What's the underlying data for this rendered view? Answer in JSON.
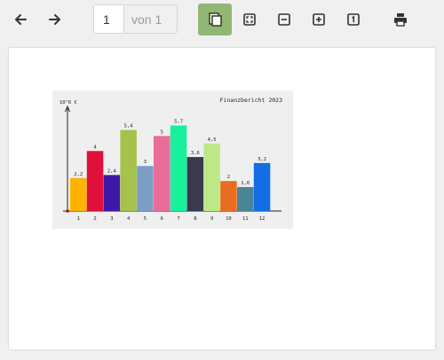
{
  "toolbar": {
    "back_icon": "arrow-left-icon",
    "forward_icon": "arrow-right-icon",
    "page_value": "1",
    "page_total": "von 1",
    "view_icon": "single-page-view-icon",
    "fit_icon": "fit-page-icon",
    "zoom_out_icon": "zoom-out-icon",
    "zoom_in_icon": "zoom-in-icon",
    "actual_size_icon": "actual-size-icon",
    "print_icon": "print-icon",
    "active_color": "#92b673"
  },
  "chart_data": {
    "type": "bar",
    "title": "Finanzbericht 2023",
    "ylabel": "10^6 €",
    "xlabel": "",
    "categories": [
      "1",
      "2",
      "3",
      "4",
      "5",
      "6",
      "7",
      "8",
      "9",
      "10",
      "11",
      "12"
    ],
    "values": [
      2.2,
      4,
      2.4,
      5.4,
      3,
      5,
      5.7,
      3.6,
      4.5,
      2,
      1.6,
      3.2
    ],
    "value_labels": [
      "2,2",
      "4",
      "2,4",
      "5,4",
      "3",
      "5",
      "5,7",
      "3,6",
      "4,5",
      "2",
      "1,6",
      "3,2"
    ],
    "colors": [
      "#ffb300",
      "#e0103a",
      "#3d1aa6",
      "#a6c24a",
      "#7c9ec6",
      "#ea6c9a",
      "#19f09c",
      "#3a3a4e",
      "#bde887",
      "#ea6d1f",
      "#4a8596",
      "#136ee6"
    ],
    "ylim": [
      0,
      6.5
    ],
    "grid": false,
    "legend": "none"
  }
}
